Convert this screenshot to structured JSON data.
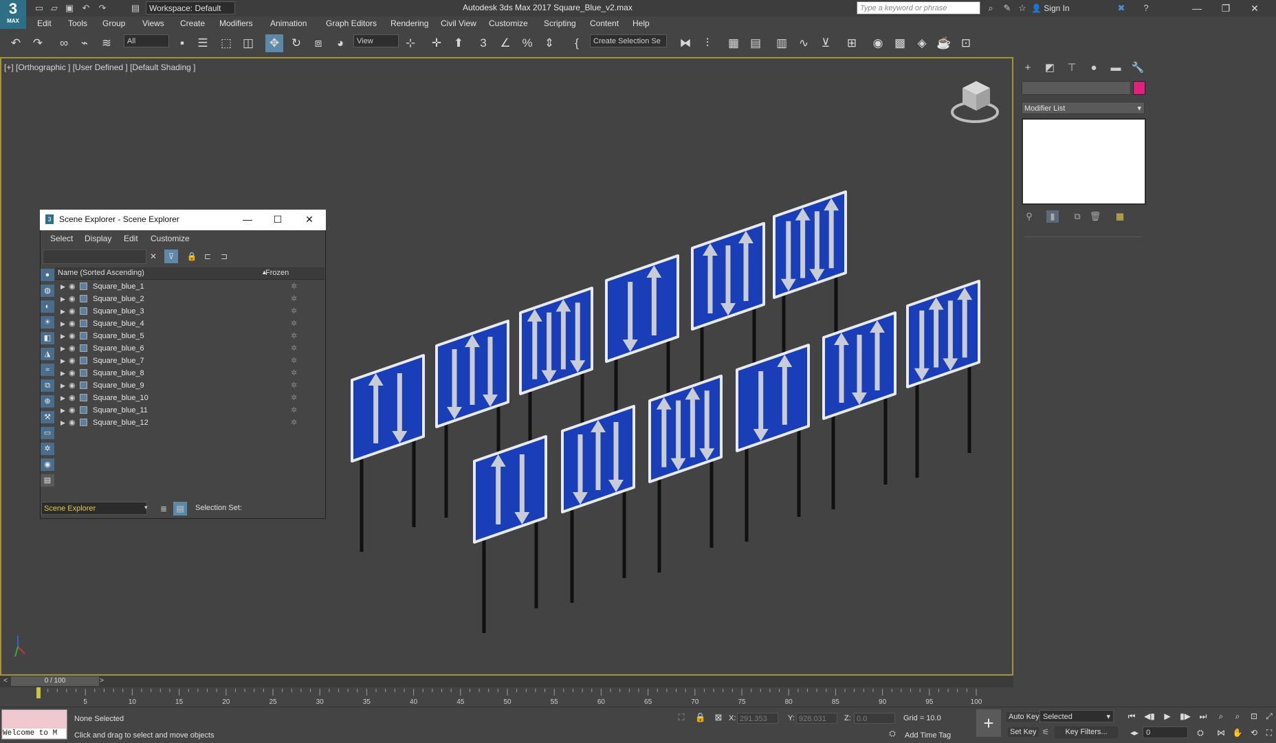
{
  "app": {
    "logo_text": "3",
    "logo_sub": "MAX",
    "title": "Autodesk 3ds Max 2017     Square_Blue_v2.max",
    "workspace_label": "Workspace: Default",
    "search_placeholder": "Type a keyword or phrase",
    "sign_in": "Sign In"
  },
  "menu": [
    "Edit",
    "Tools",
    "Group",
    "Views",
    "Create",
    "Modifiers",
    "Animation",
    "Graph Editors",
    "Rendering",
    "Civil View",
    "Customize",
    "Scripting",
    "Content",
    "Help"
  ],
  "toolbar": {
    "selection_filter": "All",
    "ref_coord": "View",
    "selection_set": "Create Selection Se"
  },
  "viewport": {
    "label": "[+] [Orthographic ] [User Defined ] [Default Shading ]"
  },
  "scene_explorer": {
    "title": "Scene Explorer - Scene Explorer",
    "menu": [
      "Select",
      "Display",
      "Edit",
      "Customize"
    ],
    "col_name": "Name (Sorted Ascending)",
    "col_frozen": "Frozen",
    "objects": [
      "Square_blue_1",
      "Square_blue_2",
      "Square_blue_3",
      "Square_blue_4",
      "Square_blue_5",
      "Square_blue_6",
      "Square_blue_7",
      "Square_blue_8",
      "Square_blue_9",
      "Square_blue_10",
      "Square_blue_11",
      "Square_blue_12"
    ],
    "scope": "Scene Explorer",
    "selection_set_label": "Selection Set:"
  },
  "command_panel": {
    "modifier_list": "Modifier List",
    "object_color": "#e0207f"
  },
  "timeline": {
    "slider_text": "0 / 100",
    "ticks": [
      "5",
      "10",
      "15",
      "20",
      "25",
      "30",
      "35",
      "40",
      "45",
      "50",
      "55",
      "60",
      "65",
      "70",
      "75",
      "80",
      "85",
      "90",
      "95",
      "100"
    ]
  },
  "status": {
    "welcome": "Welcome to M",
    "selection": "None Selected",
    "prompt": "Click and drag to select and move objects",
    "x_label": "X:",
    "x_value": "291.353",
    "y_label": "Y:",
    "y_value": "928.031",
    "z_label": "Z:",
    "z_value": "0.0",
    "grid": "Grid = 10.0",
    "add_time_tag": "Add Time Tag",
    "auto_key": "Auto Key",
    "set_key": "Set Key",
    "key_mode": "Selected",
    "key_filters": "Key Filters...",
    "frame": "0"
  },
  "colors": {
    "sign_blue": "#1a3db8",
    "sign_border": "#e8eaf5",
    "arrow": "#c8ccd6",
    "viewport_border": "#a8923a"
  }
}
